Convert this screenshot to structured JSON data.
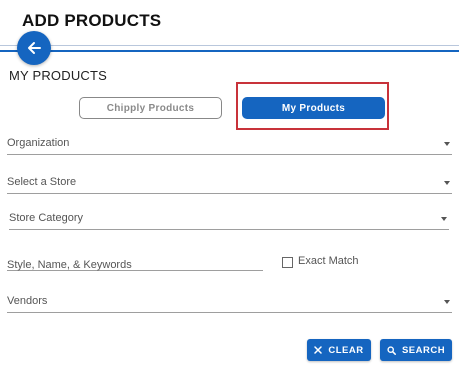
{
  "header": {
    "title": "ADD PRODUCTS"
  },
  "section": {
    "title": "MY PRODUCTS"
  },
  "toggle": {
    "chipply_label": "Chipply Products",
    "mine_label": "My Products",
    "active": "My Products"
  },
  "filters": {
    "organization_label": "Organization",
    "store_label": "Select a Store",
    "store_category_label": "Store Category",
    "keywords_placeholder": "Style, Name, & Keywords",
    "exact_match_label": "Exact Match",
    "exact_match_checked": false,
    "vendors_label": "Vendors"
  },
  "actions": {
    "clear_label": "CLEAR",
    "search_label": "SEARCH"
  },
  "colors": {
    "primary": "#1565c0",
    "highlight": "#c8323a"
  },
  "icons": {
    "back": "arrow-left-icon",
    "clear": "close-icon",
    "search": "search-icon",
    "dropdown": "caret-down-icon"
  }
}
